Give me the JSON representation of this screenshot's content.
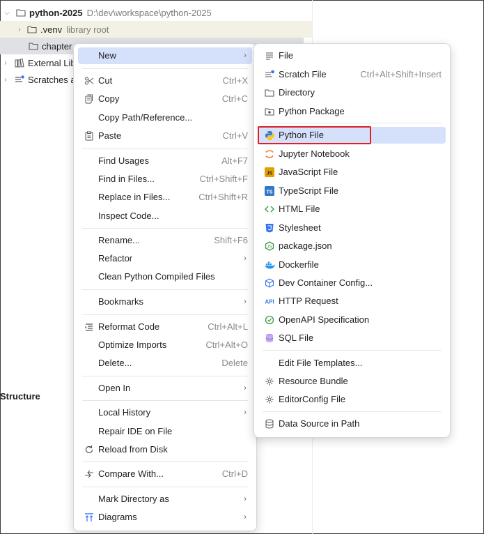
{
  "tree": {
    "project_name": "python-2025",
    "project_path": "D:\\dev\\workspace\\python-2025",
    "venv_label": ".venv",
    "venv_hint": "library root",
    "chapter_label": "chapter",
    "external_libs_label": "External Lib",
    "scratches_label": "Scratches a"
  },
  "structure_label": "Structure",
  "context_menu": {
    "new": "New",
    "cut": "Cut",
    "cut_sc": "Ctrl+X",
    "copy": "Copy",
    "copy_sc": "Ctrl+C",
    "copy_path": "Copy Path/Reference...",
    "paste": "Paste",
    "paste_sc": "Ctrl+V",
    "find_usages": "Find Usages",
    "find_usages_sc": "Alt+F7",
    "find_in_files": "Find in Files...",
    "find_in_files_sc": "Ctrl+Shift+F",
    "replace_in_files": "Replace in Files...",
    "replace_in_files_sc": "Ctrl+Shift+R",
    "inspect_code": "Inspect Code...",
    "rename": "Rename...",
    "rename_sc": "Shift+F6",
    "refactor": "Refactor",
    "clean_python": "Clean Python Compiled Files",
    "bookmarks": "Bookmarks",
    "reformat_code": "Reformat Code",
    "reformat_code_sc": "Ctrl+Alt+L",
    "optimize_imports": "Optimize Imports",
    "optimize_imports_sc": "Ctrl+Alt+O",
    "delete": "Delete...",
    "delete_sc": "Delete",
    "open_in": "Open In",
    "local_history": "Local History",
    "repair_ide": "Repair IDE on File",
    "reload_disk": "Reload from Disk",
    "compare_with": "Compare With...",
    "compare_with_sc": "Ctrl+D",
    "mark_directory": "Mark Directory as",
    "diagrams": "Diagrams"
  },
  "new_submenu": {
    "file": "File",
    "scratch_file": "Scratch File",
    "scratch_file_sc": "Ctrl+Alt+Shift+Insert",
    "directory": "Directory",
    "python_package": "Python Package",
    "python_file": "Python File",
    "jupyter": "Jupyter Notebook",
    "javascript": "JavaScript File",
    "typescript": "TypeScript File",
    "html": "HTML File",
    "stylesheet": "Stylesheet",
    "package_json": "package.json",
    "dockerfile": "Dockerfile",
    "dev_container": "Dev Container Config...",
    "http_request": "HTTP Request",
    "openapi": "OpenAPI Specification",
    "sql": "SQL File",
    "edit_templates": "Edit File Templates...",
    "resource_bundle": "Resource Bundle",
    "editorconfig": "EditorConfig File",
    "data_source": "Data Source in Path"
  },
  "colors": {
    "highlight_box": "#e11f22",
    "active_item": "#d5e1fb"
  }
}
